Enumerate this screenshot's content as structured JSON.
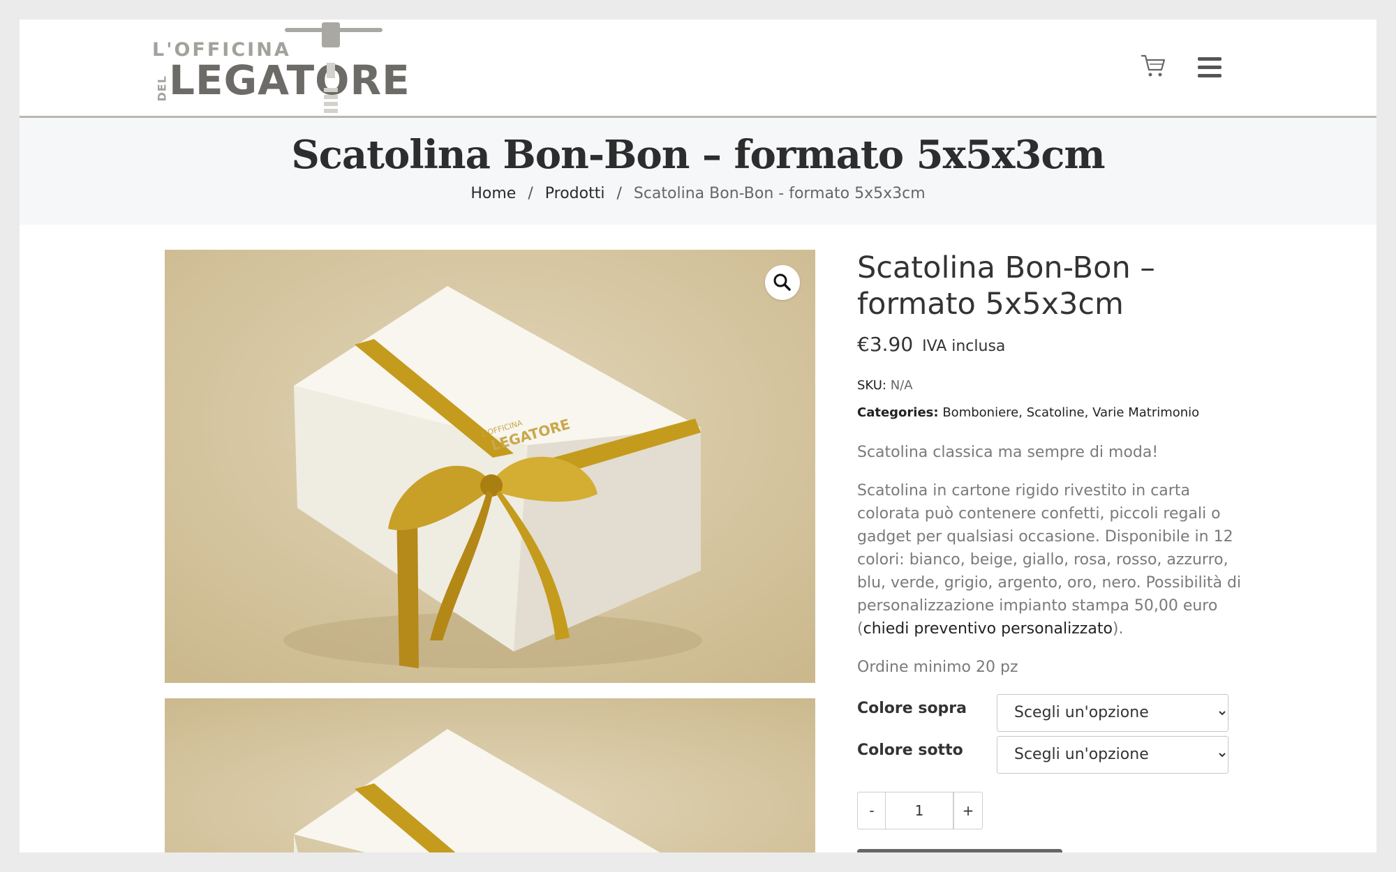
{
  "header": {
    "logo": {
      "line1": "L'OFFICINA",
      "line2": "LEGATORE",
      "del": "DEL"
    },
    "cart_icon": "cart-icon",
    "menu_icon": "hamburger-menu-icon"
  },
  "title_band": {
    "title": "Scatolina Bon-Bon – formato 5x5x3cm",
    "breadcrumb": {
      "home": "Home",
      "sep1": "/",
      "products": "Prodotti",
      "sep2": "/",
      "current": "Scatolina Bon-Bon - formato 5x5x3cm"
    }
  },
  "gallery": {
    "zoom_icon": "magnifier-icon",
    "box_logo_line1": "L'OFFICINA",
    "box_logo_line2": "LEGATORE"
  },
  "product": {
    "title": "Scatolina Bon-Bon – formato 5x5x3cm",
    "price": "€3.90",
    "price_suffix": "IVA inclusa",
    "sku_label": "SKU:",
    "sku_value": "N/A",
    "categories_label": "Categories:",
    "categories": [
      "Bomboniere",
      "Scatoline",
      "Varie Matrimonio"
    ],
    "category_sep": ", ",
    "short_description": "Scatolina classica ma sempre di moda!",
    "description": "Scatolina in cartone rigido rivestito in carta colorata può contenere confetti, piccoli regali o gadget per qualsiasi occasione. Disponibile in 12 colori: bianco, beige, giallo, rosa, rosso, azzurro, blu, verde, grigio, argento, oro, nero. Possibilità di personalizzazione impianto stampa 50,00 euro (",
    "description_link": "chiedi preventivo personalizzato",
    "description_end": ").",
    "min_order": "Ordine minimo 20 pz",
    "variations": [
      {
        "label": "Colore sopra",
        "selected": "Scegli un'opzione"
      },
      {
        "label": "Colore sotto",
        "selected": "Scegli un'opzione"
      }
    ],
    "quantity": {
      "minus": "-",
      "value": "1",
      "plus": "+"
    }
  },
  "colors": {
    "page_bg": "#ffffff",
    "outer_bg": "#ebebeb",
    "title_band_bg": "#f6f7f9",
    "ribbon_gold": "#c49b1d",
    "logo_gray": "#6d6b67"
  }
}
